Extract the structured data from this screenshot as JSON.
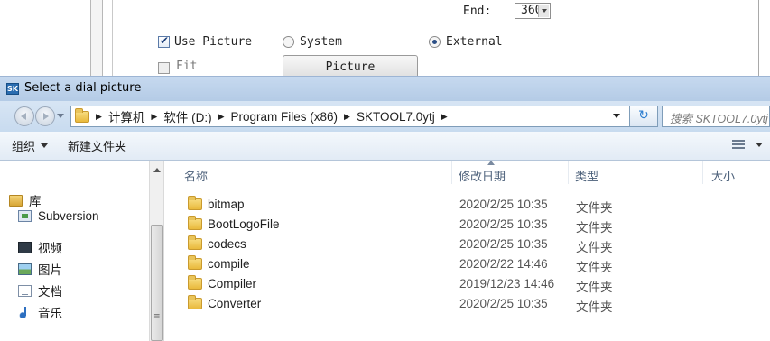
{
  "background_dialog": {
    "end_label": "End:",
    "end_value": "360",
    "use_picture_label": "Use Picture",
    "use_picture_checked": true,
    "radio_system_label": "System",
    "radio_external_label": "External",
    "selected_source": "External",
    "fit_label": "Fit",
    "picture_button_label": "Picture"
  },
  "dialog": {
    "title": "Select a dial picture",
    "title_icon_text": "SK"
  },
  "address_bar": {
    "breadcrumbs": [
      "计算机",
      "软件 (D:)",
      "Program Files (x86)",
      "SKTOOL7.0ytj"
    ],
    "search_placeholder": "搜索 SKTOOL7.0ytj"
  },
  "toolbar": {
    "organize_label": "组织",
    "new_folder_label": "新建文件夹"
  },
  "nav_pane": {
    "items": [
      {
        "label": "库",
        "icon": "library-icon"
      },
      {
        "label": "Subversion",
        "icon": "subversion-icon"
      },
      {
        "label": "视频",
        "icon": "video-icon"
      },
      {
        "label": "图片",
        "icon": "pictures-icon"
      },
      {
        "label": "文档",
        "icon": "documents-icon"
      },
      {
        "label": "音乐",
        "icon": "music-icon"
      }
    ]
  },
  "file_list": {
    "columns": {
      "name": "名称",
      "date": "修改日期",
      "type": "类型",
      "size": "大小"
    },
    "rows": [
      {
        "name": "bitmap",
        "date": "2020/2/25 10:35",
        "type": "文件夹"
      },
      {
        "name": "BootLogoFile",
        "date": "2020/2/25 10:35",
        "type": "文件夹"
      },
      {
        "name": "codecs",
        "date": "2020/2/25 10:35",
        "type": "文件夹"
      },
      {
        "name": "compile",
        "date": "2020/2/22 14:46",
        "type": "文件夹"
      },
      {
        "name": "Compiler",
        "date": "2019/12/23 14:46",
        "type": "文件夹"
      },
      {
        "name": "Converter",
        "date": "2020/2/25 10:35",
        "type": "文件夹"
      }
    ]
  },
  "colors": {
    "titlebar": "#c6d9ef",
    "toolbar": "#e2ebf5",
    "header_text": "#4c607a"
  }
}
